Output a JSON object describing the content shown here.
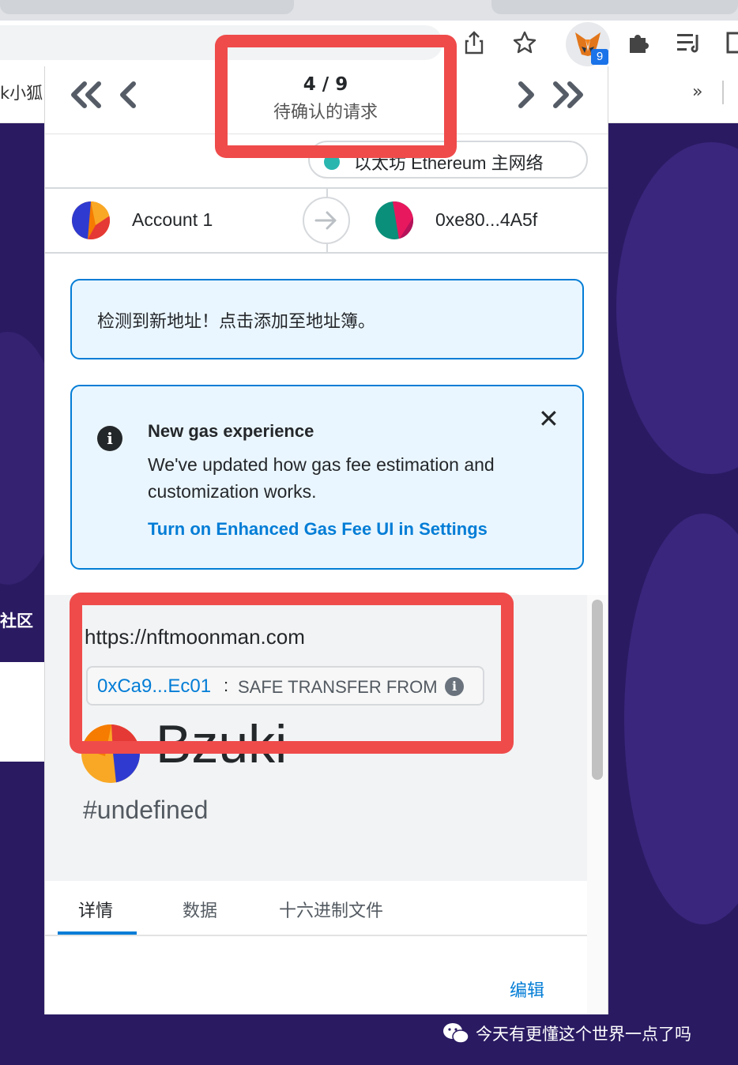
{
  "browser": {
    "bookmark_left_text": "k小狐",
    "bookmark_more": "»",
    "extension_badge": "9",
    "icons": [
      "share-icon",
      "star-icon",
      "metamask-fox-icon",
      "extensions-puzzle-icon",
      "reading-list-icon"
    ]
  },
  "background_page": {
    "side_label": "社区",
    "watermark": "今天有更懂这个世界一点了吗"
  },
  "popup": {
    "pager": {
      "count": "4 / 9",
      "label": "待确认的请求",
      "first_icon": "double-chevron-left-icon",
      "prev_icon": "chevron-left-icon",
      "next_icon": "chevron-right-icon",
      "last_icon": "double-chevron-right-icon"
    },
    "network": {
      "label": "以太坊 Ethereum 主网络",
      "dot_color": "#29b6af"
    },
    "accounts": {
      "from": "Account 1",
      "to": "0xe80...4A5f"
    },
    "new_address_notice": "检测到新地址！点击添加至地址簿。",
    "gas_notice": {
      "title": "New gas experience",
      "body": "We've updated how gas fee estimation and customization works.",
      "link": "Turn on Enhanced Gas Fee UI in Settings"
    },
    "origin": {
      "url": "https://nftmoonman.com",
      "contract": "0xCa9...Ec01",
      "separator": ":",
      "method": "SAFE TRANSFER FROM"
    },
    "title": "Bzuki",
    "subtitle": "#undefined",
    "tabs": [
      "详情",
      "数据",
      "十六进制文件"
    ],
    "edit_label": "编辑"
  },
  "colors": {
    "accent": "#037dd6",
    "annotation_red": "#ef4b4b",
    "page_bg": "#2a1a62"
  }
}
